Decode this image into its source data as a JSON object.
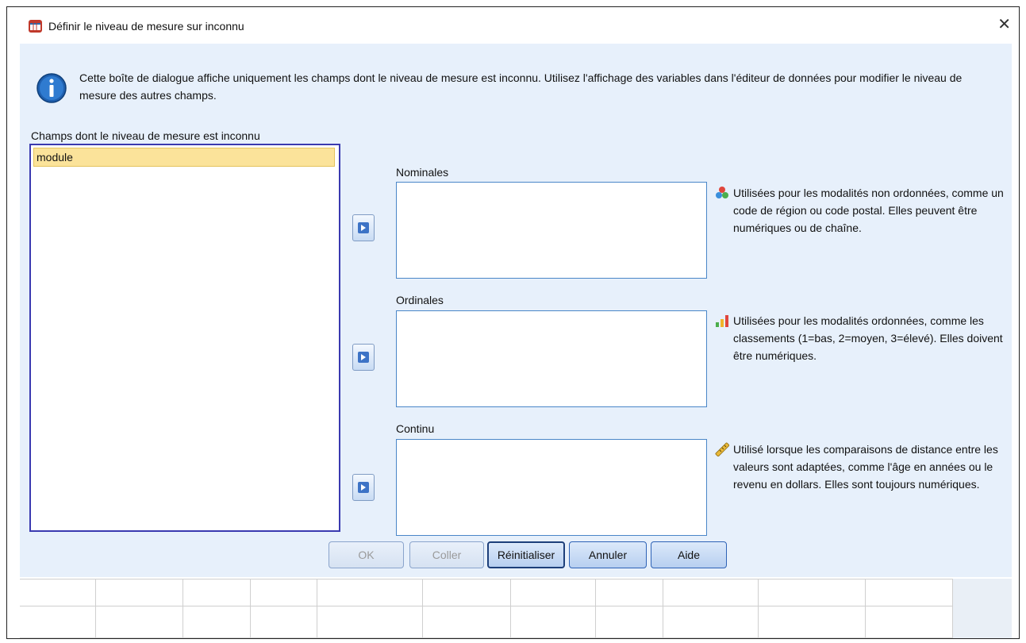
{
  "window": {
    "title": "Définir le niveau de mesure sur inconnu",
    "close_symbol": "✕"
  },
  "info": {
    "icon": "info-icon",
    "text": "Cette boîte de dialogue affiche uniquement les champs dont le niveau de mesure est inconnu. Utilisez l'affichage des variables dans l'éditeur de données pour modifier le niveau de mesure des autres champs."
  },
  "source": {
    "label": "Champs dont le niveau de mesure est inconnu",
    "items": [
      "module"
    ]
  },
  "targets": {
    "nominal": {
      "label": "Nominales",
      "icon": "nominal-measure-icon",
      "description": "Utilisées pour les modalités non ordonnées, comme un code de région ou code postal. Elles peuvent être numériques ou de chaîne."
    },
    "ordinal": {
      "label": "Ordinales",
      "icon": "ordinal-measure-icon",
      "description": "Utilisées pour les modalités ordonnées, comme les classements (1=bas, 2=moyen, 3=élevé). Elles doivent être numériques."
    },
    "continuous": {
      "label": "Continu",
      "icon": "scale-measure-icon",
      "description": "Utilisé lorsque les comparaisons de distance entre les valeurs sont adaptées, comme l'âge en années ou le revenu en dollars. Elles sont toujours numériques."
    }
  },
  "buttons": {
    "ok": "OK",
    "paste": "Coller",
    "reset": "Réinitialiser",
    "cancel": "Annuler",
    "help": "Aide"
  },
  "colors": {
    "dialog_bg": "#e7f0fb",
    "selected_item": "#fbe39a",
    "list_border": "#3a3ab0",
    "button_border": "#2d62b6"
  }
}
